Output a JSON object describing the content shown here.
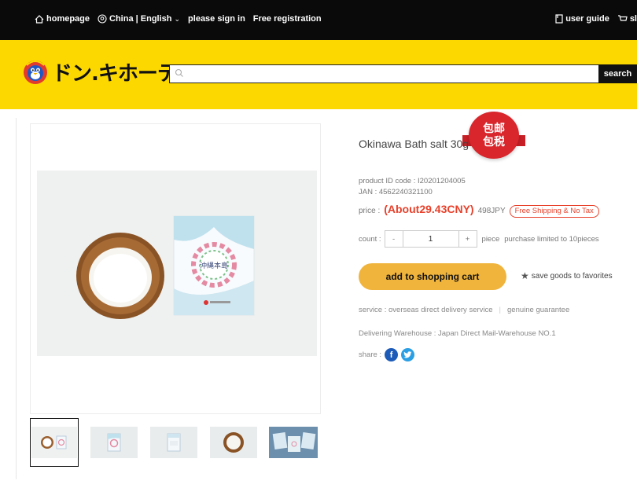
{
  "topbar": {
    "homepage": "homepage",
    "region": "China | English",
    "sign_in": "please sign in",
    "register": "Free registration",
    "user_guide": "user guide",
    "cart_partial": "sl"
  },
  "header": {
    "logo_text": "ドン.キホーテ",
    "search_placeholder": "",
    "search_button": "search"
  },
  "product": {
    "title": "Okinawa Bath salt 30g",
    "badge_line1": "包邮",
    "badge_line2": "包税",
    "product_id": "product ID code : I20201204005",
    "jan": "JAN : 4562240321100",
    "price_label": "price :",
    "price_cny": "(About29.43CNY)",
    "price_jpy": "498JPY",
    "free_shipping": "Free Shipping & No Tax",
    "count_label": "count :",
    "minus": "-",
    "quantity": "1",
    "plus": "+",
    "piece": "piece",
    "limit": "purchase limited to 10pieces",
    "add_to_cart": "add to shopping cart",
    "favorites": "save goods to favorites",
    "service": "service : overseas direct delivery service",
    "guarantee": "genuine guarantee",
    "warehouse": "Delivering Warehouse : Japan Direct Mail-Warehouse NO.1",
    "share_label": "share :",
    "package_text": "沖縄本島"
  },
  "colors": {
    "header_yellow": "#fdd800",
    "topbar_black": "#0a0a0a",
    "price_red": "#e8402a",
    "cart_button": "#f0b43c",
    "badge_red": "#d8262c"
  }
}
